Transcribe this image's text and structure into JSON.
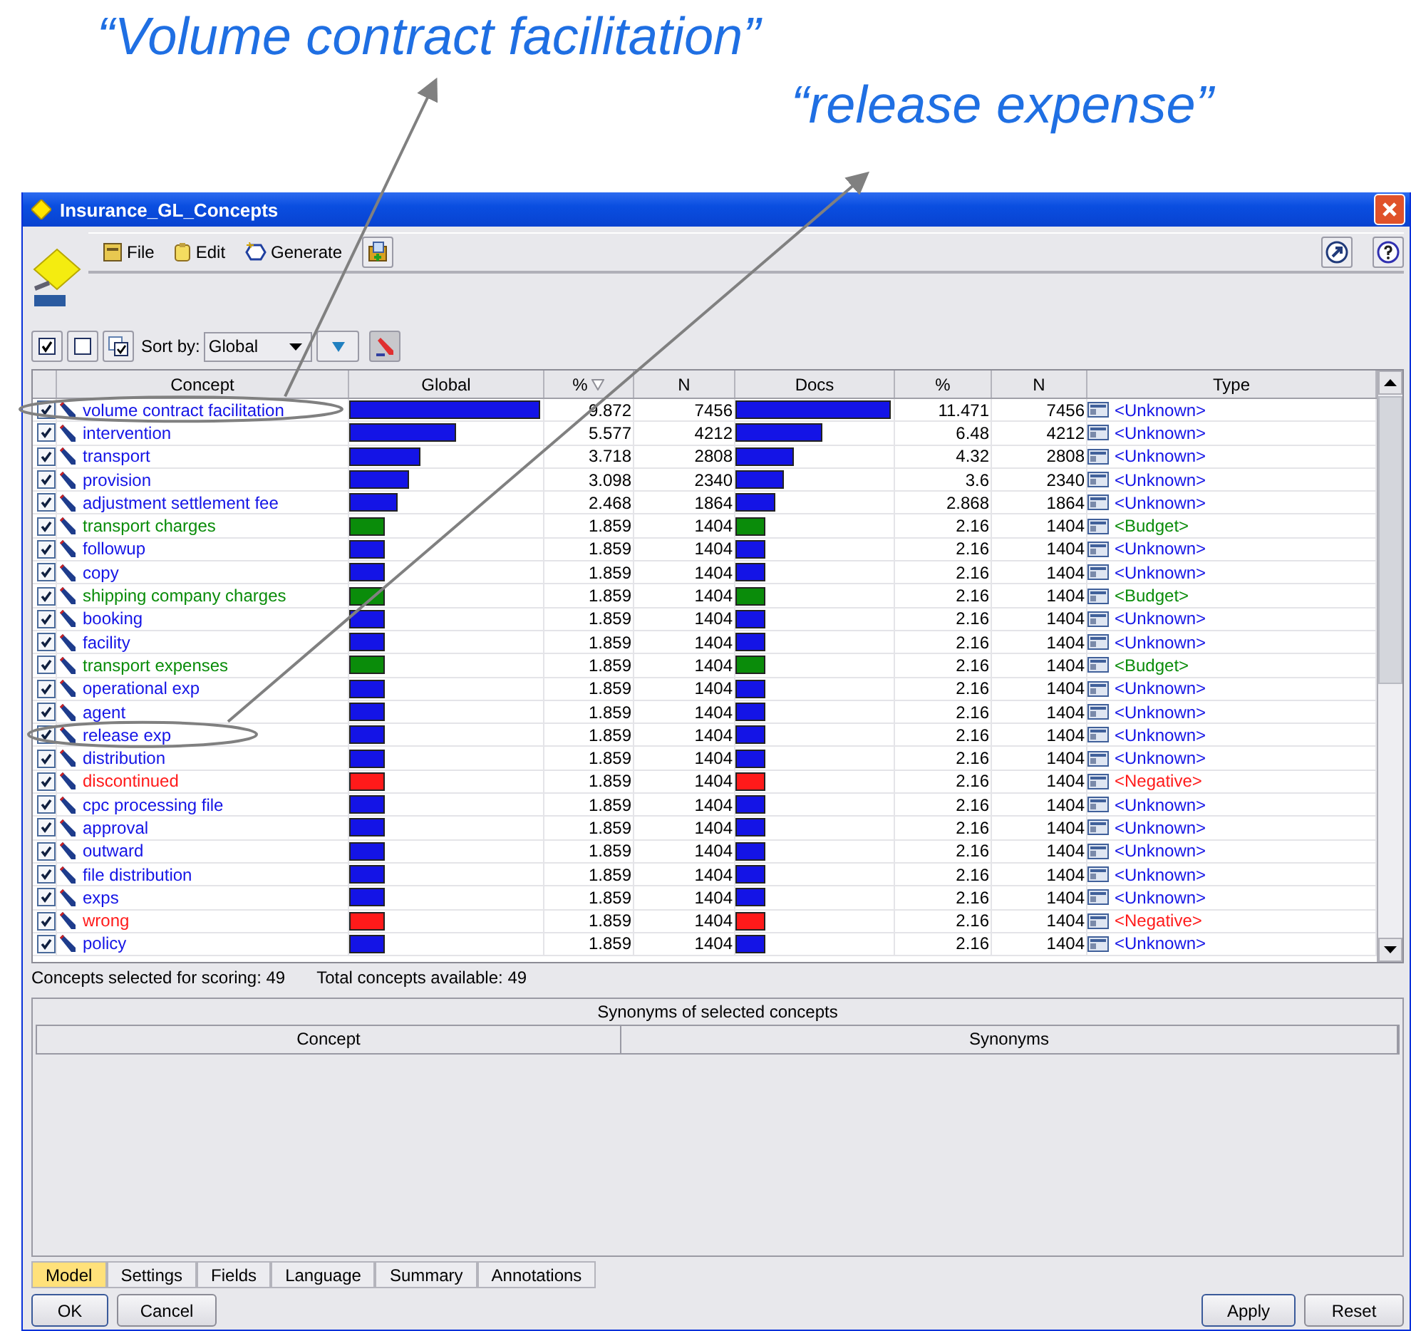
{
  "annotations": [
    {
      "text": "“Volume contract facilitation”"
    },
    {
      "text": "“release expense”"
    }
  ],
  "window": {
    "title": "Insurance_GL_Concepts"
  },
  "menu": [
    {
      "label": "File",
      "kind": "file"
    },
    {
      "label": "Edit",
      "kind": "edit"
    },
    {
      "label": "Generate",
      "kind": "generate"
    }
  ],
  "sort": {
    "label": "Sort by:",
    "value": "Global"
  },
  "table": {
    "columns": [
      "Concept",
      "Global",
      "%",
      "N",
      "Docs",
      "%",
      "N",
      "Type"
    ],
    "rows": [
      {
        "checked": true,
        "concept": "volume contract facilitation",
        "color": "#1414e6",
        "global_bar": {
          "level": 0.985
        },
        "pct": "9.872",
        "n": "7456",
        "docs_bar": {
          "level": 0.98
        },
        "pct2": "11.471",
        "n2": "7456",
        "type": "<Unknown>",
        "circled": true
      },
      {
        "checked": true,
        "concept": "intervention",
        "color": "#1414e6",
        "global_bar": {
          "level": 0.55
        },
        "pct": "5.577",
        "n": "4212",
        "docs_bar": {
          "level": 0.55
        },
        "pct2": "6.48",
        "n2": "4212",
        "type": "<Unknown>",
        "circled": false
      },
      {
        "checked": true,
        "concept": "transport",
        "color": "#1414e6",
        "global_bar": {
          "level": 0.37
        },
        "pct": "3.718",
        "n": "2808",
        "docs_bar": {
          "level": 0.37
        },
        "pct2": "4.32",
        "n2": "2808",
        "type": "<Unknown>",
        "circled": false
      },
      {
        "checked": true,
        "concept": "provision",
        "color": "#1414e6",
        "global_bar": {
          "level": 0.31
        },
        "pct": "3.098",
        "n": "2340",
        "docs_bar": {
          "level": 0.31
        },
        "pct2": "3.6",
        "n2": "2340",
        "type": "<Unknown>",
        "circled": false
      },
      {
        "checked": true,
        "concept": "adjustment settlement fee",
        "color": "#1414e6",
        "global_bar": {
          "level": 0.25
        },
        "pct": "2.468",
        "n": "1864",
        "docs_bar": {
          "level": 0.25
        },
        "pct2": "2.868",
        "n2": "1864",
        "type": "<Unknown>",
        "circled": false
      },
      {
        "checked": true,
        "concept": "transport charges",
        "color": "#0a8c0a",
        "global_bar": {
          "level": 0.185
        },
        "pct": "1.859",
        "n": "1404",
        "docs_bar": {
          "level": 0.19
        },
        "pct2": "2.16",
        "n2": "1404",
        "type": "<Budget>",
        "circled": false
      },
      {
        "checked": true,
        "concept": "followup",
        "color": "#1414e6",
        "global_bar": {
          "level": 0.185
        },
        "pct": "1.859",
        "n": "1404",
        "docs_bar": {
          "level": 0.19
        },
        "pct2": "2.16",
        "n2": "1404",
        "type": "<Unknown>",
        "circled": false
      },
      {
        "checked": true,
        "concept": "copy",
        "color": "#1414e6",
        "global_bar": {
          "level": 0.185
        },
        "pct": "1.859",
        "n": "1404",
        "docs_bar": {
          "level": 0.19
        },
        "pct2": "2.16",
        "n2": "1404",
        "type": "<Unknown>",
        "circled": false
      },
      {
        "checked": true,
        "concept": "shipping company charges",
        "color": "#0a8c0a",
        "global_bar": {
          "level": 0.185
        },
        "pct": "1.859",
        "n": "1404",
        "docs_bar": {
          "level": 0.19
        },
        "pct2": "2.16",
        "n2": "1404",
        "type": "<Budget>",
        "circled": false
      },
      {
        "checked": true,
        "concept": "booking",
        "color": "#1414e6",
        "global_bar": {
          "level": 0.185
        },
        "pct": "1.859",
        "n": "1404",
        "docs_bar": {
          "level": 0.19
        },
        "pct2": "2.16",
        "n2": "1404",
        "type": "<Unknown>",
        "circled": false
      },
      {
        "checked": true,
        "concept": "facility",
        "color": "#1414e6",
        "global_bar": {
          "level": 0.185
        },
        "pct": "1.859",
        "n": "1404",
        "docs_bar": {
          "level": 0.19
        },
        "pct2": "2.16",
        "n2": "1404",
        "type": "<Unknown>",
        "circled": false
      },
      {
        "checked": true,
        "concept": "transport expenses",
        "color": "#0a8c0a",
        "global_bar": {
          "level": 0.185
        },
        "pct": "1.859",
        "n": "1404",
        "docs_bar": {
          "level": 0.19
        },
        "pct2": "2.16",
        "n2": "1404",
        "type": "<Budget>",
        "circled": false
      },
      {
        "checked": true,
        "concept": "operational exp",
        "color": "#1414e6",
        "global_bar": {
          "level": 0.185
        },
        "pct": "1.859",
        "n": "1404",
        "docs_bar": {
          "level": 0.19
        },
        "pct2": "2.16",
        "n2": "1404",
        "type": "<Unknown>",
        "circled": false
      },
      {
        "checked": true,
        "concept": "agent",
        "color": "#1414e6",
        "global_bar": {
          "level": 0.185
        },
        "pct": "1.859",
        "n": "1404",
        "docs_bar": {
          "level": 0.19
        },
        "pct2": "2.16",
        "n2": "1404",
        "type": "<Unknown>",
        "circled": false
      },
      {
        "checked": true,
        "concept": "release exp",
        "color": "#1414e6",
        "global_bar": {
          "level": 0.185
        },
        "pct": "1.859",
        "n": "1404",
        "docs_bar": {
          "level": 0.19
        },
        "pct2": "2.16",
        "n2": "1404",
        "type": "<Unknown>",
        "circled": true
      },
      {
        "checked": true,
        "concept": "distribution",
        "color": "#1414e6",
        "global_bar": {
          "level": 0.185
        },
        "pct": "1.859",
        "n": "1404",
        "docs_bar": {
          "level": 0.19
        },
        "pct2": "2.16",
        "n2": "1404",
        "type": "<Unknown>",
        "circled": false
      },
      {
        "checked": true,
        "concept": "discontinued",
        "color": "#ff1a1a",
        "global_bar": {
          "level": 0.185
        },
        "pct": "1.859",
        "n": "1404",
        "docs_bar": {
          "level": 0.19
        },
        "pct2": "2.16",
        "n2": "1404",
        "type": "<Negative>",
        "circled": false
      },
      {
        "checked": true,
        "concept": "cpc processing file",
        "color": "#1414e6",
        "global_bar": {
          "level": 0.185
        },
        "pct": "1.859",
        "n": "1404",
        "docs_bar": {
          "level": 0.19
        },
        "pct2": "2.16",
        "n2": "1404",
        "type": "<Unknown>",
        "circled": false
      },
      {
        "checked": true,
        "concept": "approval",
        "color": "#1414e6",
        "global_bar": {
          "level": 0.185
        },
        "pct": "1.859",
        "n": "1404",
        "docs_bar": {
          "level": 0.19
        },
        "pct2": "2.16",
        "n2": "1404",
        "type": "<Unknown>",
        "circled": false
      },
      {
        "checked": true,
        "concept": "outward",
        "color": "#1414e6",
        "global_bar": {
          "level": 0.185
        },
        "pct": "1.859",
        "n": "1404",
        "docs_bar": {
          "level": 0.19
        },
        "pct2": "2.16",
        "n2": "1404",
        "type": "<Unknown>",
        "circled": false
      },
      {
        "checked": true,
        "concept": "file distribution",
        "color": "#1414e6",
        "global_bar": {
          "level": 0.185
        },
        "pct": "1.859",
        "n": "1404",
        "docs_bar": {
          "level": 0.19
        },
        "pct2": "2.16",
        "n2": "1404",
        "type": "<Unknown>",
        "circled": false
      },
      {
        "checked": true,
        "concept": "exps",
        "color": "#1414e6",
        "global_bar": {
          "level": 0.185
        },
        "pct": "1.859",
        "n": "1404",
        "docs_bar": {
          "level": 0.19
        },
        "pct2": "2.16",
        "n2": "1404",
        "type": "<Unknown>",
        "circled": false
      },
      {
        "checked": true,
        "concept": "wrong",
        "color": "#ff1a1a",
        "global_bar": {
          "level": 0.185
        },
        "pct": "1.859",
        "n": "1404",
        "docs_bar": {
          "level": 0.19
        },
        "pct2": "2.16",
        "n2": "1404",
        "type": "<Negative>",
        "circled": false
      },
      {
        "checked": true,
        "concept": "policy",
        "color": "#1414e6",
        "global_bar": {
          "level": 0.185
        },
        "pct": "1.859",
        "n": "1404",
        "docs_bar": {
          "level": 0.19
        },
        "pct2": "2.16",
        "n2": "1404",
        "type": "<Unknown>",
        "circled": false
      }
    ]
  },
  "status": [
    "Concepts selected for scoring: 49",
    "Total concepts available: 49"
  ],
  "synonyms": {
    "title": "Synonyms of selected concepts",
    "columns": [
      "Concept",
      "Synonyms"
    ]
  },
  "tabs": [
    {
      "label": "Model",
      "selected": true
    },
    {
      "label": "Settings",
      "selected": false
    },
    {
      "label": "Fields",
      "selected": false
    },
    {
      "label": "Language",
      "selected": false
    },
    {
      "label": "Summary",
      "selected": false
    },
    {
      "label": "Annotations",
      "selected": false
    }
  ],
  "buttons_left": [
    "OK",
    "Cancel"
  ],
  "buttons_right": [
    "Apply",
    "Reset"
  ]
}
